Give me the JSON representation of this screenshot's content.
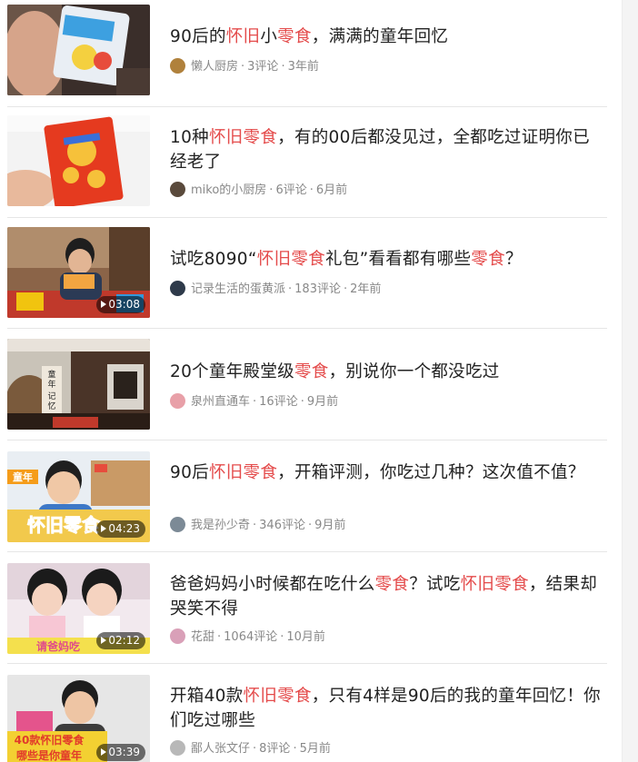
{
  "feed": {
    "items": [
      {
        "title_parts": [
          {
            "t": "90后的",
            "hl": false
          },
          {
            "t": "怀旧",
            "hl": true
          },
          {
            "t": "小",
            "hl": false
          },
          {
            "t": "零食",
            "hl": true
          },
          {
            "t": "，满满的童年回忆",
            "hl": false
          }
        ],
        "author": "懒人厨房",
        "comments": "3评论",
        "time": "3年前",
        "duration": "",
        "avatar_color": "#b0813c"
      },
      {
        "title_parts": [
          {
            "t": "10种",
            "hl": false
          },
          {
            "t": "怀旧零食",
            "hl": true
          },
          {
            "t": "，有的00后都没见过，全都吃过证明你已经老了",
            "hl": false
          }
        ],
        "author": "miko的小厨房",
        "comments": "6评论",
        "time": "6月前",
        "duration": "",
        "avatar_color": "#5a4a3c"
      },
      {
        "title_parts": [
          {
            "t": "试吃8090“",
            "hl": false
          },
          {
            "t": "怀旧零食",
            "hl": true
          },
          {
            "t": "礼包”看看都有哪些",
            "hl": false
          },
          {
            "t": "零食",
            "hl": true
          },
          {
            "t": "？",
            "hl": false
          }
        ],
        "author": "记录生活的蛋黄派",
        "comments": "183评论",
        "time": "2年前",
        "duration": "03:08",
        "avatar_color": "#2e3a4a"
      },
      {
        "title_parts": [
          {
            "t": "20个童年殿堂级",
            "hl": false
          },
          {
            "t": "零食",
            "hl": true
          },
          {
            "t": "，别说你一个都没吃过",
            "hl": false
          }
        ],
        "author": "泉州直通车",
        "comments": "16评论",
        "time": "9月前",
        "duration": "",
        "avatar_color": "#e8a0a8"
      },
      {
        "title_parts": [
          {
            "t": "90后",
            "hl": false
          },
          {
            "t": "怀旧零食",
            "hl": true
          },
          {
            "t": "，开箱评测，你吃过几种？这次值不值？",
            "hl": false
          }
        ],
        "author": "我是孙少奇",
        "comments": "346评论",
        "time": "9月前",
        "duration": "04:23",
        "avatar_color": "#7c8a96"
      },
      {
        "title_parts": [
          {
            "t": "爸爸妈妈小时候都在吃什么",
            "hl": false
          },
          {
            "t": "零食",
            "hl": true
          },
          {
            "t": "？试吃",
            "hl": false
          },
          {
            "t": "怀旧零食",
            "hl": true
          },
          {
            "t": "，结果却哭笑不得",
            "hl": false
          }
        ],
        "author": "花甜",
        "comments": "1064评论",
        "time": "10月前",
        "duration": "02:12",
        "avatar_color": "#d9a0b8"
      },
      {
        "title_parts": [
          {
            "t": "开箱40款",
            "hl": false
          },
          {
            "t": "怀旧零食",
            "hl": true
          },
          {
            "t": "，只有4样是90后的我的童年回忆！你们吃过哪些",
            "hl": false
          }
        ],
        "author": "鄙人张文仔",
        "comments": "8评论",
        "time": "5月前",
        "duration": "03:39",
        "avatar_color": "#b8b8b8"
      }
    ]
  },
  "thumb_text": {
    "item4": [
      "童",
      "年",
      "记",
      "忆"
    ],
    "item5_a": "童年",
    "item5_b": "怀旧零食",
    "item6": "请爸妈吃",
    "item7_a": "40款怀旧零食",
    "item7_b": "哪些是你童年"
  },
  "meta_separator": "·"
}
